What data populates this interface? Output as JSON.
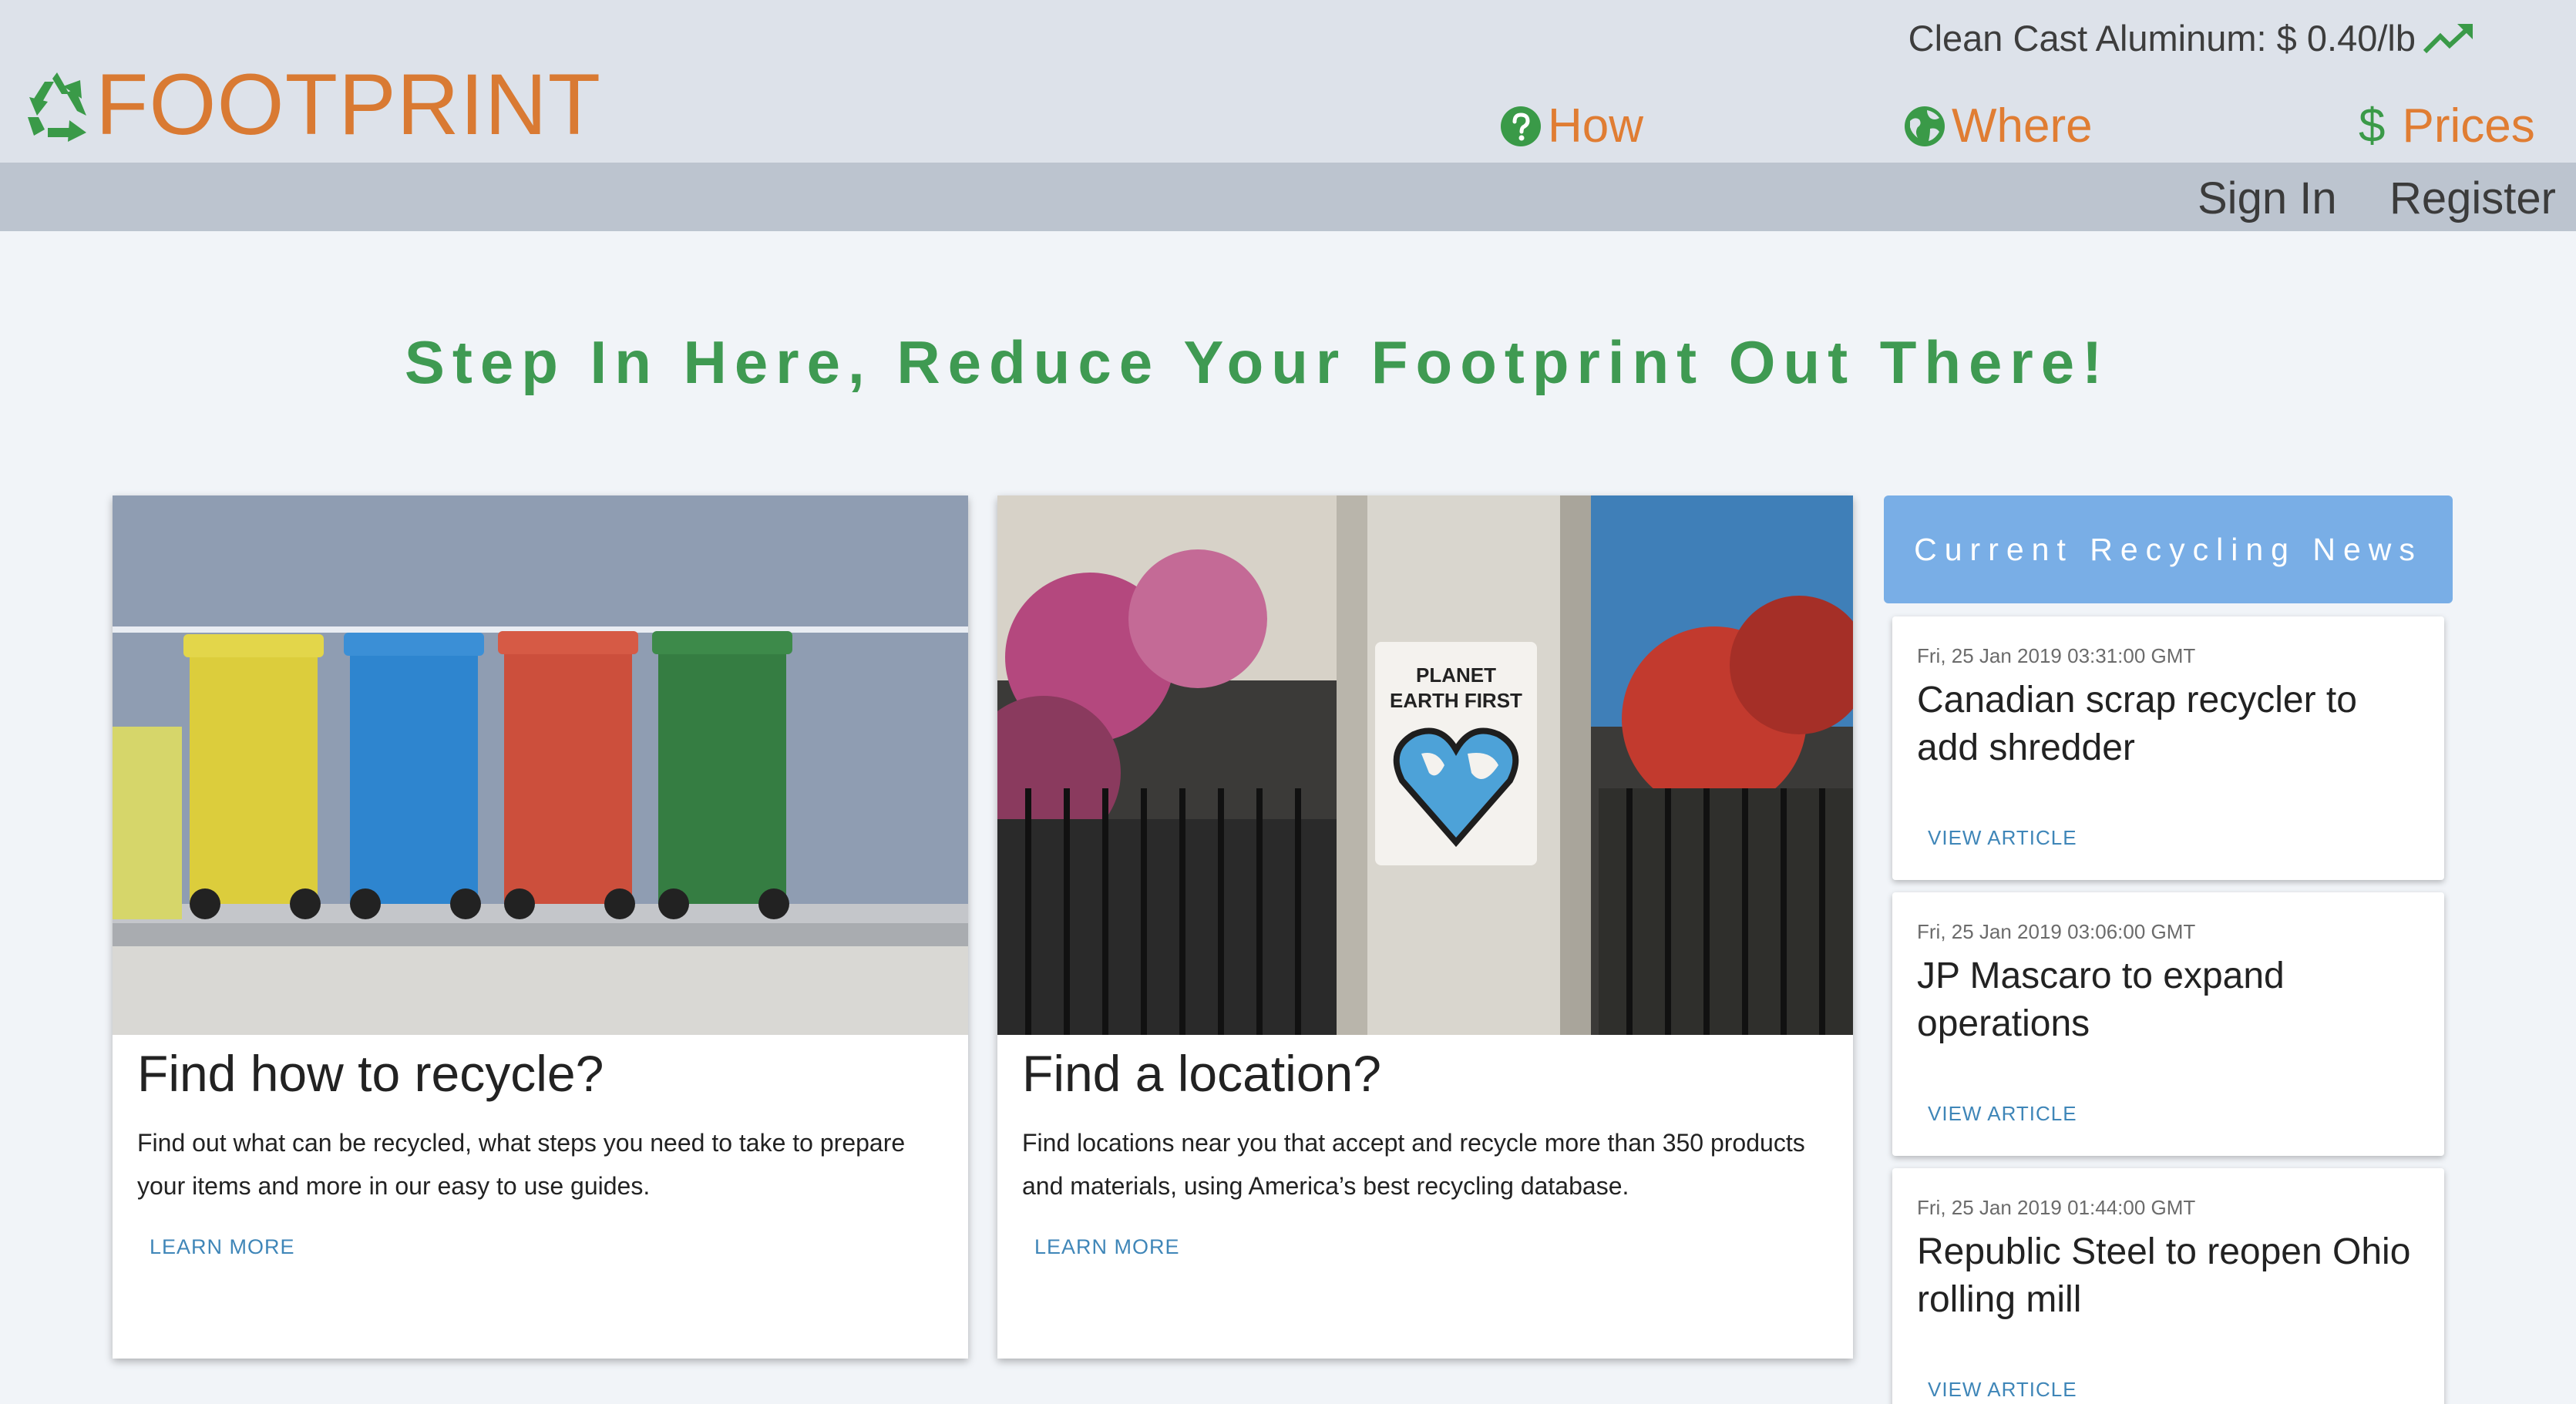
{
  "header": {
    "logo_text": "FOOTPRINT",
    "price_ticker": "Clean Cast Aluminum: $ 0.40/lb",
    "nav": {
      "how": "How",
      "where": "Where",
      "prices": "Prices",
      "prices_symbol": "$"
    },
    "auth": {
      "sign_in": "Sign In",
      "register": "Register"
    }
  },
  "hero": {
    "title": "Step In Here, Reduce Your Footprint Out There!"
  },
  "cards": [
    {
      "title": "Find how to recycle?",
      "description": "Find out what can be recycled, what steps you need to take to prepare your items and more in our easy to use guides.",
      "link": "LEARN MORE"
    },
    {
      "title": "Find a location?",
      "description": "Find locations near you that accept and recycle more than 350 products and materials, using America’s best recycling database.",
      "link": "LEARN MORE",
      "sticker_line1": "PLANET",
      "sticker_line2": "EARTH FIRST"
    }
  ],
  "news": {
    "header": "Current Recycling News",
    "items": [
      {
        "date": "Fri, 25 Jan 2019 03:31:00 GMT",
        "headline": "Canadian scrap recycler to add shredder",
        "link": "VIEW ARTICLE"
      },
      {
        "date": "Fri, 25 Jan 2019 03:06:00 GMT",
        "headline": "JP Mascaro to expand operations",
        "link": "VIEW ARTICLE"
      },
      {
        "date": "Fri, 25 Jan 2019 01:44:00 GMT",
        "headline": "Republic Steel to reopen Ohio rolling mill",
        "link": "VIEW ARTICLE"
      }
    ]
  },
  "colors": {
    "brand_orange": "#d97a33",
    "brand_green": "#3f9a52",
    "news_blue": "#79aee6",
    "link_blue": "#3f86b8"
  },
  "icons": {
    "logo": "recycle-icon",
    "trend": "trending-up-icon",
    "how": "question-circle-icon",
    "where": "globe-icon",
    "prices": "dollar-icon"
  }
}
